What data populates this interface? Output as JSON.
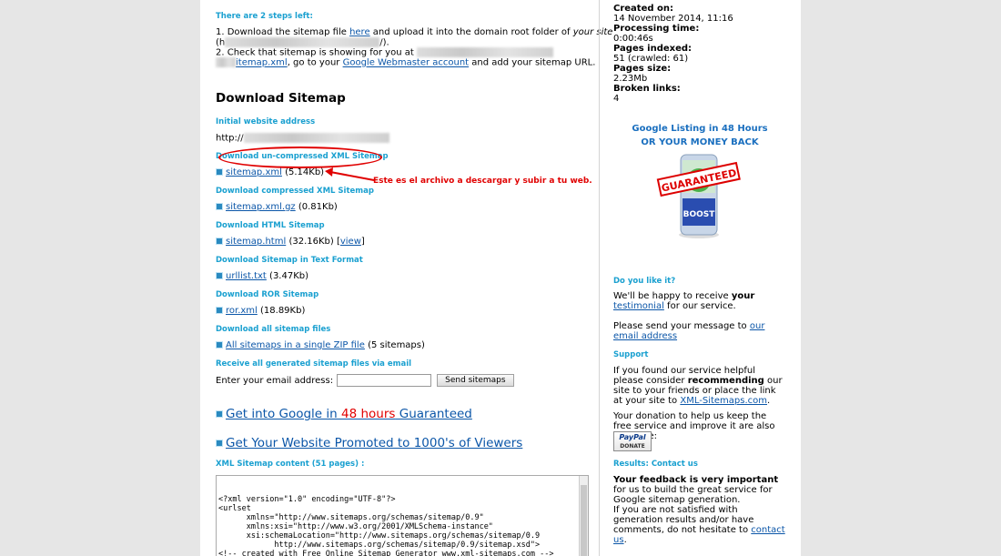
{
  "steps": {
    "heading": "There are 2 steps left:",
    "step1_a": "1. Download the sitemap file ",
    "step1_link": "here",
    "step1_b": " and upload it into the domain root folder of ",
    "step1_italic": "your site",
    "step1_c1": "(h",
    "step1_c2": "/).",
    "step2_a": "2. Check that sitemap is showing for you at ",
    "step2_link": "itemap.xml",
    "step2_b": ", go to your ",
    "step2_link2": "Google Webmaster account",
    "step2_c": " and add your sitemap URL."
  },
  "download": {
    "title": "Download Sitemap",
    "initial_label": "Initial website address",
    "initial_value": "http://",
    "items": [
      {
        "heading": "Download un-compressed XML Sitemap",
        "link": "sitemap.xml",
        "size": "(5.14Kb)"
      },
      {
        "heading": "Download compressed XML Sitemap",
        "link": "sitemap.xml.gz",
        "size": "(0.81Kb)"
      },
      {
        "heading": "Download HTML Sitemap",
        "link": "sitemap.html",
        "size": "(32.16Kb) [",
        "extra_link": "view",
        "extra_end": "]"
      },
      {
        "heading": "Download Sitemap in Text Format",
        "link": "urllist.txt",
        "size": "(3.47Kb)"
      },
      {
        "heading": "Download ROR Sitemap",
        "link": "ror.xml",
        "size": "(18.89Kb)"
      },
      {
        "heading": "Download all sitemap files",
        "link": "All sitemaps in a single ZIP file",
        "size": "(5 sitemaps)"
      }
    ],
    "email_heading": "Receive all generated sitemap files via email",
    "email_label": "Enter your email address:",
    "send_button": "Send sitemaps",
    "promo1_a": "Get into Google in ",
    "promo1_red": "48 hours",
    "promo1_b": " Guaranteed",
    "promo2": "Get Your Website Promoted to 1000's of Viewers",
    "xml_heading": "XML Sitemap content (51 pages) :",
    "xml_content": "<?xml version=\"1.0\" encoding=\"UTF-8\"?>\n<urlset\n      xmlns=\"http://www.sitemaps.org/schemas/sitemap/0.9\"\n      xmlns:xsi=\"http://www.w3.org/2001/XMLSchema-instance\"\n      xsi:schemaLocation=\"http://www.sitemaps.org/schemas/sitemap/0.9\n            http://www.sitemaps.org/schemas/sitemap/0.9/sitemap.xsd\">\n<!-- created with Free Online Sitemap Generator www.xml-sitemaps.com -->\n\n<url>"
  },
  "annotation": {
    "text": "Este es el archivo a descargar y subir a tu web."
  },
  "sidebar": {
    "created_label": "Created on:",
    "created_value": "14 November 2014, 11:16",
    "processing_label": "Processing time:",
    "processing_value": "0:00:46s",
    "pages_label": "Pages indexed:",
    "pages_value": "51 (crawled: 61)",
    "size_label": "Pages size:",
    "size_value": "2.23Mb",
    "broken_label": "Broken links:",
    "broken_value": "4",
    "ad_line1_a": "Google Listing in ",
    "ad_line1_b": "48 Hours",
    "ad_line2": "OR YOUR MONEY BACK",
    "ad_badge": "GUARANTEED",
    "like_heading": "Do you like it?",
    "like_a": "We'll be happy to receive ",
    "like_bold": "your",
    "like_link": "testimonial",
    "like_b": " for our service.",
    "msg_a": "Please send your message to ",
    "msg_link": "our email address",
    "support_heading": "Support",
    "support_a": "If you found our service helpful please consider ",
    "support_bold": "recommending",
    "support_b": " our site to your friends or place the link at your site to ",
    "support_link": "XML-Sitemaps.com",
    "support_c": ".",
    "donation": "Your donation to help us keep the free service and improve it are also welcome:",
    "paypal_top": "PayPal",
    "paypal_bottom": "DONATE",
    "results_heading": "Results: Contact us",
    "feedback_bold": "Your feedback is very important",
    "feedback_a": " for us to build the great service for Google sitemap generation.",
    "feedback_b": "If you are not satisfied with generation results and/or have comments, do not hesitate to ",
    "feedback_link": "contact us",
    "feedback_c": "."
  },
  "colors": {
    "accent": "#1aa0d0",
    "link": "#0b56a8",
    "annotation": "#e00000",
    "background": "#e6e6e6"
  }
}
